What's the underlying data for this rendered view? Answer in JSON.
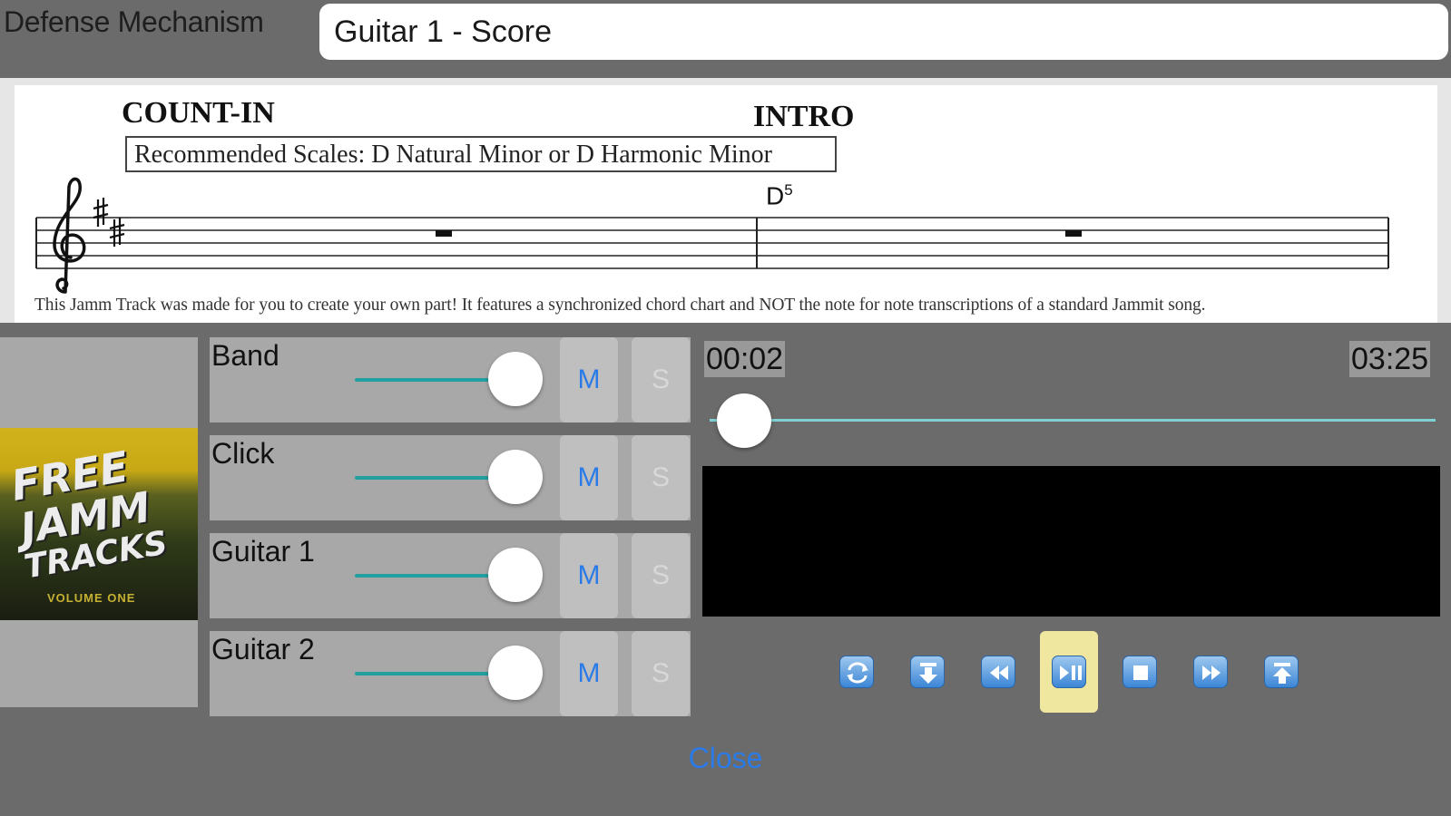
{
  "header": {
    "song_title": "Defense Mechanism",
    "part_title": "Guitar 1 - Score"
  },
  "score": {
    "section1": "COUNT-IN",
    "section2": "INTRO",
    "scale_note": "Recommended Scales: D Natural Minor or D Harmonic Minor",
    "chord": "D",
    "chord_sup": "5",
    "footnote": "This Jamm Track was made for you to create your own part! It features a synchronized chord chart and NOT the note for note transcriptions of a standard Jammit song."
  },
  "album": {
    "line1": "FREE",
    "line2": "JAMM",
    "line3": "TRACKS",
    "line4": "VOLUME ONE"
  },
  "tracks": [
    {
      "name": "Band",
      "mute": "M",
      "solo": "S",
      "level": 1.0
    },
    {
      "name": "Click",
      "mute": "M",
      "solo": "S",
      "level": 1.0
    },
    {
      "name": "Guitar 1",
      "mute": "M",
      "solo": "S",
      "level": 1.0
    },
    {
      "name": "Guitar 2",
      "mute": "M",
      "solo": "S",
      "level": 1.0
    }
  ],
  "player": {
    "current_time": "00:02",
    "total_time": "03:25",
    "position_fraction": 0.01
  },
  "transport": [
    {
      "icon": "loop-icon"
    },
    {
      "icon": "go-to-start-icon"
    },
    {
      "icon": "rewind-icon"
    },
    {
      "icon": "play-pause-icon",
      "active": true
    },
    {
      "icon": "stop-icon"
    },
    {
      "icon": "fast-forward-icon"
    },
    {
      "icon": "go-to-end-icon"
    }
  ],
  "footer": {
    "close_label": "Close"
  },
  "colors": {
    "accent": "#2a7be8",
    "slider": "#22a0a0",
    "panel": "#a8a8a8",
    "background": "#6b6b6b",
    "active_transport": "#efe6a0"
  }
}
